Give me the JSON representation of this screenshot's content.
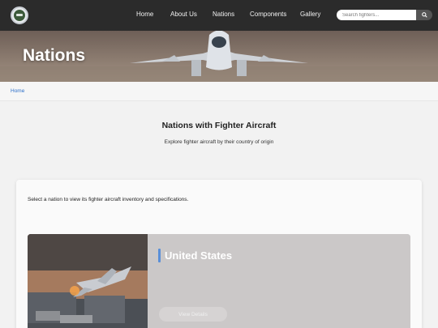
{
  "nav": {
    "links": [
      "Home",
      "About Us",
      "Nations",
      "Components",
      "Gallery"
    ],
    "search_placeholder": "Search fighters...",
    "search_icon": "search-icon",
    "logo_icon": "emblem-logo"
  },
  "hero": {
    "title": "Nations"
  },
  "breadcrumb": {
    "home": "Home"
  },
  "intro": {
    "heading": "Nations with Fighter Aircraft",
    "subheading": "Explore fighter aircraft by their country of origin"
  },
  "selector": {
    "instruction": "Select a nation to view its fighter aircraft inventory and specifications."
  },
  "nation": {
    "name": "United States",
    "button_label": "View Details"
  },
  "colors": {
    "navbar": "#2b2b2b",
    "link": "#2c6fc9",
    "accent_bar": "#5a8fd8"
  }
}
